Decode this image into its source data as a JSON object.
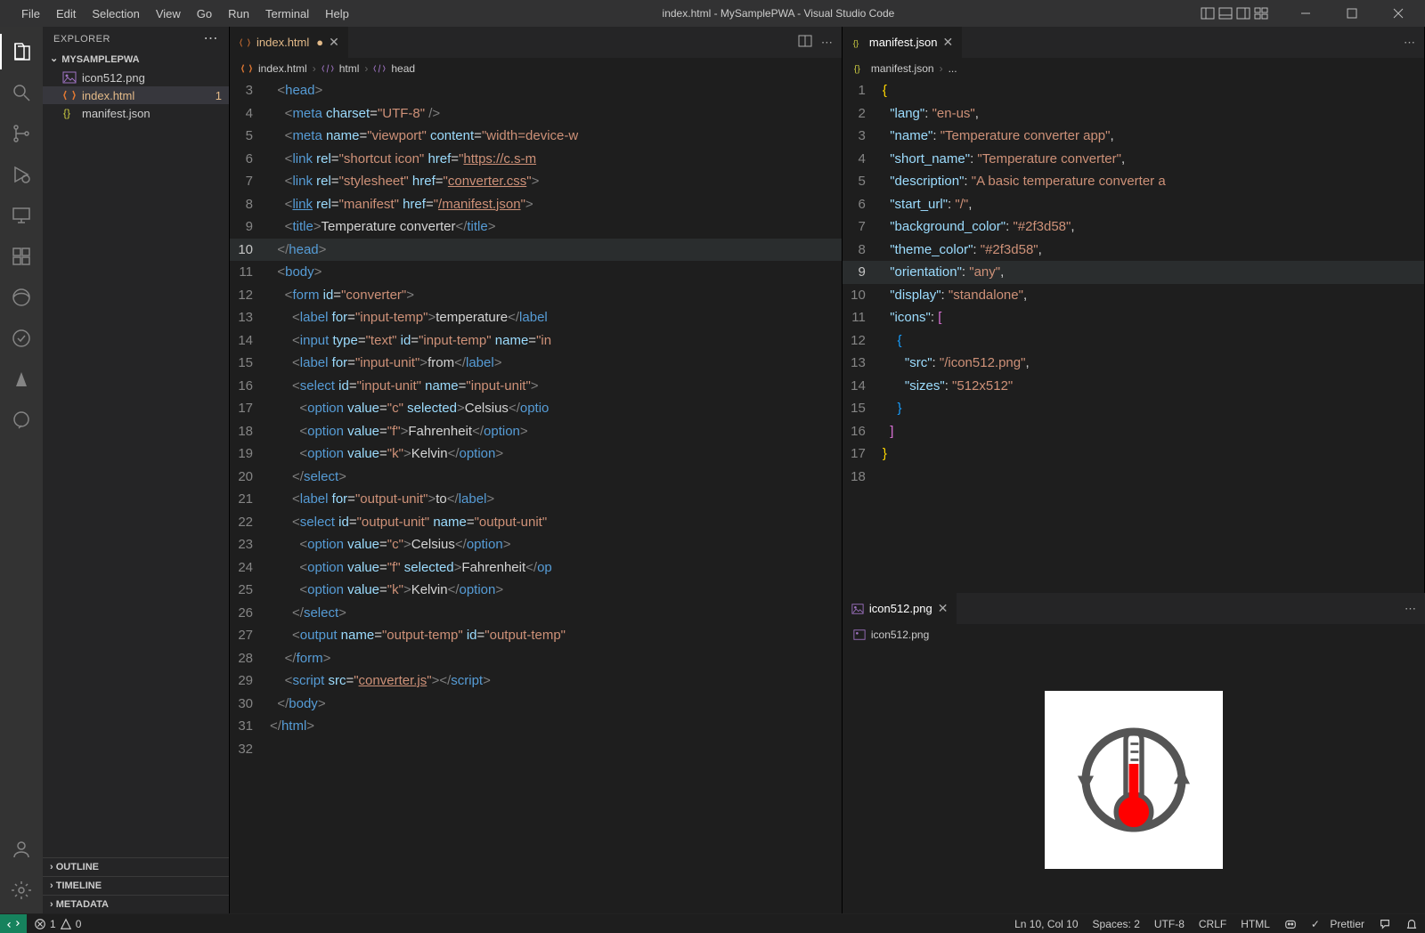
{
  "title": "index.html - MySamplePWA - Visual Studio Code",
  "menu": [
    "File",
    "Edit",
    "Selection",
    "View",
    "Go",
    "Run",
    "Terminal",
    "Help"
  ],
  "explorer": {
    "title": "EXPLORER",
    "folder": "MYSAMPLEPWA",
    "files": [
      {
        "name": "icon512.png",
        "icon": "image",
        "active": false
      },
      {
        "name": "index.html",
        "icon": "html",
        "active": true,
        "badge": "1"
      },
      {
        "name": "manifest.json",
        "icon": "json",
        "active": false
      }
    ],
    "sections": [
      "OUTLINE",
      "TIMELINE",
      "METADATA"
    ]
  },
  "editor_left": {
    "tab": {
      "name": "index.html",
      "icon": "html",
      "modified": true,
      "dot": "●"
    },
    "breadcrumbs": [
      {
        "icon": "html",
        "text": "index.html"
      },
      {
        "icon": "tag",
        "text": "html"
      },
      {
        "icon": "tag",
        "text": "head"
      }
    ],
    "code": [
      {
        "n": 3,
        "html": "  <span class='b'>&lt;</span><span class='t'>head</span><span class='b'>&gt;</span>"
      },
      {
        "n": 4,
        "html": "    <span class='b'>&lt;</span><span class='t'>meta</span> <span class='a'>charset</span>=<span class='s'>\"UTF-8\"</span> <span class='b'>/&gt;</span>"
      },
      {
        "n": 5,
        "html": "    <span class='b'>&lt;</span><span class='t'>meta</span> <span class='a'>name</span>=<span class='s'>\"viewport\"</span> <span class='a'>content</span>=<span class='s'>\"width=device-w</span>"
      },
      {
        "n": 6,
        "html": "    <span class='b'>&lt;</span><span class='t'>link</span> <span class='a'>rel</span>=<span class='s'>\"shortcut icon\"</span> <span class='a'>href</span>=<span class='s'>\"<span class='ul'>https://c.s-m</span></span>"
      },
      {
        "n": 7,
        "html": "    <span class='b'>&lt;</span><span class='t'>link</span> <span class='a'>rel</span>=<span class='s'>\"stylesheet\"</span> <span class='a'>href</span>=<span class='s'>\"<span class='ul'>converter.css</span>\"</span><span class='b'>&gt;</span>"
      },
      {
        "n": 8,
        "html": "    <span class='b'>&lt;</span><span class='t ul'>link</span> <span class='a'>rel</span>=<span class='s'>\"manifest\"</span> <span class='a'>href</span>=<span class='s'>\"<span class='ul'>/manifest.json</span>\"</span><span class='b'>&gt;</span>"
      },
      {
        "n": 9,
        "html": "    <span class='b'>&lt;</span><span class='t'>title</span><span class='b'>&gt;</span>Temperature converter<span class='b'>&lt;/</span><span class='t'>title</span><span class='b'>&gt;</span>"
      },
      {
        "n": 10,
        "hl": true,
        "html": "  <span class='b'>&lt;/</span><span class='t'>head</span><span class='b'>&gt;</span>"
      },
      {
        "n": 11,
        "html": "  <span class='b'>&lt;</span><span class='t'>body</span><span class='b'>&gt;</span>"
      },
      {
        "n": 12,
        "html": "    <span class='b'>&lt;</span><span class='t'>form</span> <span class='a'>id</span>=<span class='s'>\"converter\"</span><span class='b'>&gt;</span>"
      },
      {
        "n": 13,
        "html": "      <span class='b'>&lt;</span><span class='t'>label</span> <span class='a'>for</span>=<span class='s'>\"input-temp\"</span><span class='b'>&gt;</span>temperature<span class='b'>&lt;/</span><span class='t'>label</span>"
      },
      {
        "n": 14,
        "html": "      <span class='b'>&lt;</span><span class='t'>input</span> <span class='a'>type</span>=<span class='s'>\"text\"</span> <span class='a'>id</span>=<span class='s'>\"input-temp\"</span> <span class='a'>name</span>=<span class='s'>\"in</span>"
      },
      {
        "n": 15,
        "html": "      <span class='b'>&lt;</span><span class='t'>label</span> <span class='a'>for</span>=<span class='s'>\"input-unit\"</span><span class='b'>&gt;</span>from<span class='b'>&lt;/</span><span class='t'>label</span><span class='b'>&gt;</span>"
      },
      {
        "n": 16,
        "html": "      <span class='b'>&lt;</span><span class='t'>select</span> <span class='a'>id</span>=<span class='s'>\"input-unit\"</span> <span class='a'>name</span>=<span class='s'>\"input-unit\"</span><span class='b'>&gt;</span>"
      },
      {
        "n": 17,
        "html": "        <span class='b'>&lt;</span><span class='t'>option</span> <span class='a'>value</span>=<span class='s'>\"c\"</span> <span class='a'>selected</span><span class='b'>&gt;</span>Celsius<span class='b'>&lt;/</span><span class='t'>optio</span>"
      },
      {
        "n": 18,
        "html": "        <span class='b'>&lt;</span><span class='t'>option</span> <span class='a'>value</span>=<span class='s'>\"f\"</span><span class='b'>&gt;</span>Fahrenheit<span class='b'>&lt;/</span><span class='t'>option</span><span class='b'>&gt;</span>"
      },
      {
        "n": 19,
        "html": "        <span class='b'>&lt;</span><span class='t'>option</span> <span class='a'>value</span>=<span class='s'>\"k\"</span><span class='b'>&gt;</span>Kelvin<span class='b'>&lt;/</span><span class='t'>option</span><span class='b'>&gt;</span>"
      },
      {
        "n": 20,
        "html": "      <span class='b'>&lt;/</span><span class='t'>select</span><span class='b'>&gt;</span>"
      },
      {
        "n": 21,
        "html": "      <span class='b'>&lt;</span><span class='t'>label</span> <span class='a'>for</span>=<span class='s'>\"output-unit\"</span><span class='b'>&gt;</span>to<span class='b'>&lt;/</span><span class='t'>label</span><span class='b'>&gt;</span>"
      },
      {
        "n": 22,
        "html": "      <span class='b'>&lt;</span><span class='t'>select</span> <span class='a'>id</span>=<span class='s'>\"output-unit\"</span> <span class='a'>name</span>=<span class='s'>\"output-unit\"</span>"
      },
      {
        "n": 23,
        "html": "        <span class='b'>&lt;</span><span class='t'>option</span> <span class='a'>value</span>=<span class='s'>\"c\"</span><span class='b'>&gt;</span>Celsius<span class='b'>&lt;/</span><span class='t'>option</span><span class='b'>&gt;</span>"
      },
      {
        "n": 24,
        "html": "        <span class='b'>&lt;</span><span class='t'>option</span> <span class='a'>value</span>=<span class='s'>\"f\"</span> <span class='a'>selected</span><span class='b'>&gt;</span>Fahrenheit<span class='b'>&lt;/</span><span class='t'>op</span>"
      },
      {
        "n": 25,
        "html": "        <span class='b'>&lt;</span><span class='t'>option</span> <span class='a'>value</span>=<span class='s'>\"k\"</span><span class='b'>&gt;</span>Kelvin<span class='b'>&lt;/</span><span class='t'>option</span><span class='b'>&gt;</span>"
      },
      {
        "n": 26,
        "html": "      <span class='b'>&lt;/</span><span class='t'>select</span><span class='b'>&gt;</span>"
      },
      {
        "n": 27,
        "html": "      <span class='b'>&lt;</span><span class='t'>output</span> <span class='a'>name</span>=<span class='s'>\"output-temp\"</span> <span class='a'>id</span>=<span class='s'>\"output-temp\"</span>"
      },
      {
        "n": 28,
        "html": "    <span class='b'>&lt;/</span><span class='t'>form</span><span class='b'>&gt;</span>"
      },
      {
        "n": 29,
        "html": "    <span class='b'>&lt;</span><span class='t'>script</span> <span class='a'>src</span>=<span class='s'>\"<span class='ul'>converter.js</span>\"</span><span class='b'>&gt;&lt;/</span><span class='t'>script</span><span class='b'>&gt;</span>"
      },
      {
        "n": 30,
        "html": "  <span class='b'>&lt;/</span><span class='t'>body</span><span class='b'>&gt;</span>"
      },
      {
        "n": 31,
        "html": "<span class='b'>&lt;/</span><span class='t'>html</span><span class='b'>&gt;</span>"
      },
      {
        "n": 32,
        "html": ""
      }
    ]
  },
  "editor_right_top": {
    "tab": {
      "name": "manifest.json",
      "icon": "json"
    },
    "breadcrumbs": [
      {
        "icon": "json",
        "text": "manifest.json"
      },
      {
        "text": "..."
      }
    ],
    "code": [
      {
        "n": 1,
        "html": "<span class='by'>{</span>"
      },
      {
        "n": 2,
        "html": "  <span class='k'>\"lang\"</span>: <span class='s'>\"en-us\"</span>,"
      },
      {
        "n": 3,
        "html": "  <span class='k'>\"name\"</span>: <span class='s'>\"Temperature converter app\"</span>,"
      },
      {
        "n": 4,
        "html": "  <span class='k'>\"short_name\"</span>: <span class='s'>\"Temperature converter\"</span>,"
      },
      {
        "n": 5,
        "html": "  <span class='k'>\"description\"</span>: <span class='s'>\"A basic temperature converter a</span>"
      },
      {
        "n": 6,
        "html": "  <span class='k'>\"start_url\"</span>: <span class='s'>\"/\"</span>,"
      },
      {
        "n": 7,
        "html": "  <span class='k'>\"background_color\"</span>: <span class='s'>\"#2f3d58\"</span>,"
      },
      {
        "n": 8,
        "html": "  <span class='k'>\"theme_color\"</span>: <span class='s'>\"#2f3d58\"</span>,"
      },
      {
        "n": 9,
        "hl": true,
        "html": "  <span class='k'>\"orientation\"</span>: <span class='s'>\"any\"</span>,"
      },
      {
        "n": 10,
        "html": "  <span class='k'>\"display\"</span>: <span class='s'>\"standalone\"</span>,"
      },
      {
        "n": 11,
        "html": "  <span class='k'>\"icons\"</span>: <span class='bp'>[</span>"
      },
      {
        "n": 12,
        "html": "    <span class='bb'>{</span>"
      },
      {
        "n": 13,
        "html": "      <span class='k'>\"src\"</span>: <span class='s'>\"/icon512.png\"</span>,"
      },
      {
        "n": 14,
        "html": "      <span class='k'>\"sizes\"</span>: <span class='s'>\"512x512\"</span>"
      },
      {
        "n": 15,
        "html": "    <span class='bb'>}</span>"
      },
      {
        "n": 16,
        "html": "  <span class='bp'>]</span>"
      },
      {
        "n": 17,
        "html": "<span class='by'>}</span>"
      },
      {
        "n": 18,
        "html": ""
      }
    ]
  },
  "editor_right_bottom": {
    "tab": {
      "name": "icon512.png",
      "icon": "image"
    },
    "crumb": "icon512.png"
  },
  "status": {
    "errors": "1",
    "warnings": "0",
    "pos": "Ln 10, Col 10",
    "spaces": "Spaces: 2",
    "encoding": "UTF-8",
    "eol": "CRLF",
    "lang": "HTML",
    "prettier": "Prettier"
  }
}
